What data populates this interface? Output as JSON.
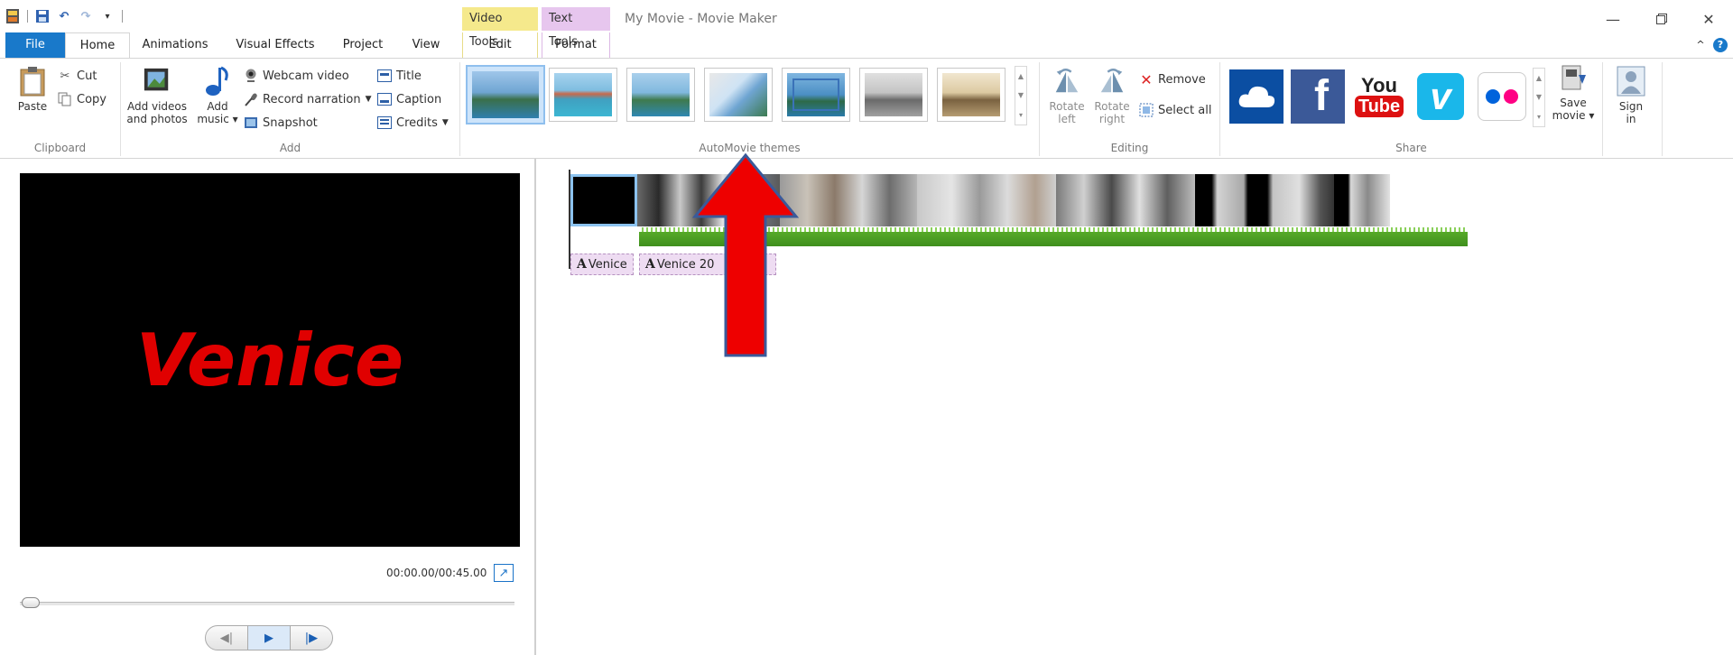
{
  "window": {
    "title": "My Movie - Movie Maker",
    "context_tab_video": "Video Tools",
    "context_tab_text": "Text Tools"
  },
  "tabs": [
    {
      "label": "File"
    },
    {
      "label": "Home"
    },
    {
      "label": "Animations"
    },
    {
      "label": "Visual Effects"
    },
    {
      "label": "Project"
    },
    {
      "label": "View"
    },
    {
      "label": "Edit"
    },
    {
      "label": "Format"
    }
  ],
  "ribbon": {
    "clipboard": {
      "label": "Clipboard",
      "paste": "Paste",
      "cut": "Cut",
      "copy": "Copy"
    },
    "add": {
      "label": "Add",
      "add_videos_line1": "Add videos",
      "add_videos_line2": "and photos",
      "add_music_line1": "Add",
      "add_music_line2": "music",
      "webcam": "Webcam video",
      "narration": "Record narration",
      "snapshot": "Snapshot",
      "title": "Title",
      "caption": "Caption",
      "credits": "Credits"
    },
    "themes": {
      "label": "AutoMovie themes"
    },
    "editing": {
      "label": "Editing",
      "rotate_left_line1": "Rotate",
      "rotate_left_line2": "left",
      "rotate_right_line1": "Rotate",
      "rotate_right_line2": "right",
      "remove": "Remove",
      "select_all": "Select all"
    },
    "share": {
      "label": "Share",
      "youtube_line1": "You",
      "youtube_line2": "Tube",
      "save_movie_line1": "Save",
      "save_movie_line2": "movie",
      "sign_in_line1": "Sign",
      "sign_in_line2": "in"
    }
  },
  "preview": {
    "overlay_text": "Venice",
    "time": "00:00.00/00:45.00"
  },
  "storyboard": {
    "captions": [
      {
        "text": "Venice"
      },
      {
        "text": "Venice 20"
      }
    ]
  },
  "colors": {
    "file_tab": "#1979ca",
    "video_tools": "#f5e98c",
    "text_tools": "#e7c6ee",
    "title_red": "#e00000",
    "arrow_red": "#ee0000",
    "arrow_outline": "#3a5a9a",
    "audio_green": "#4aa020"
  }
}
